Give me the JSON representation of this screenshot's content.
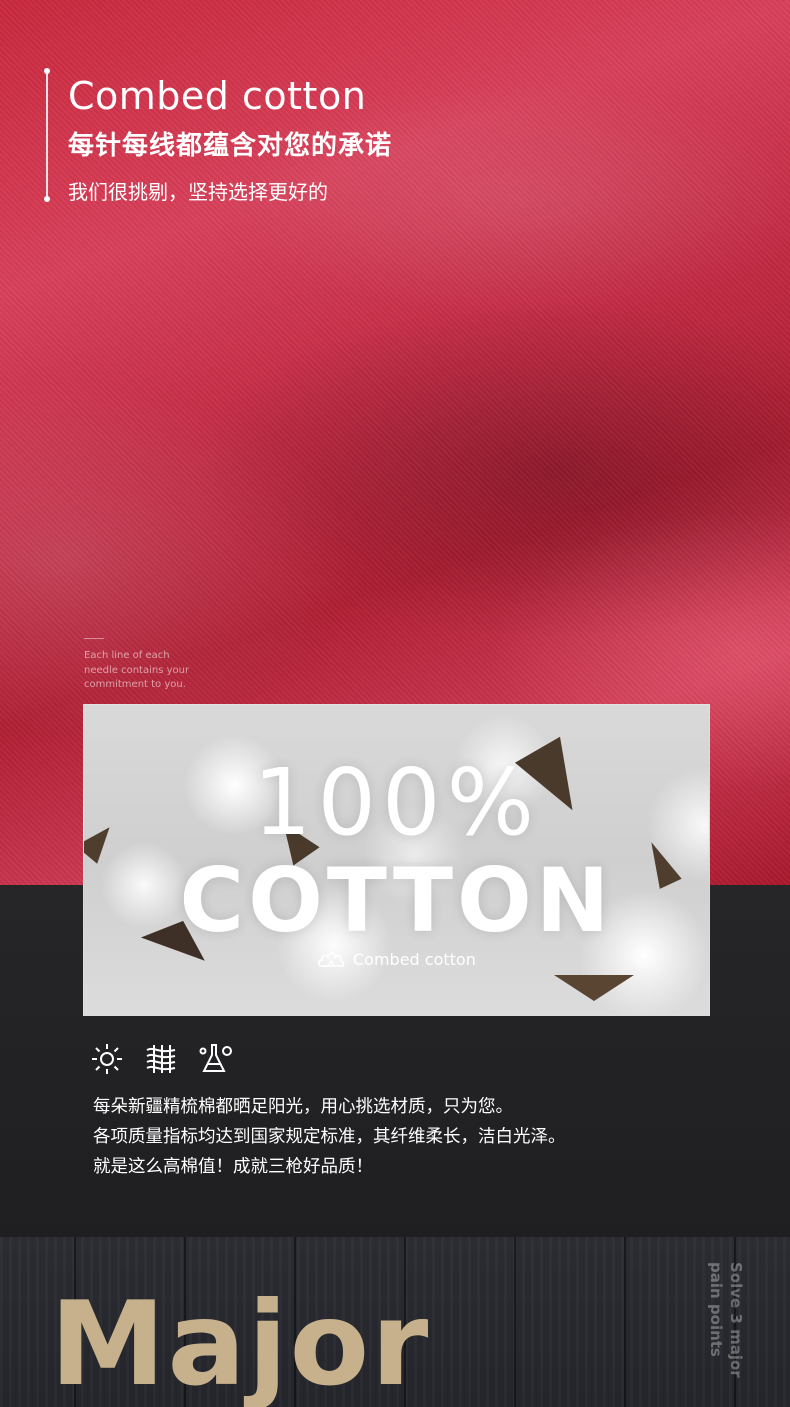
{
  "header": {
    "title": "Combed cotton",
    "subtitle": "每针每线都蕴含对您的承诺",
    "tagline": "我们很挑剔，坚持选择更好的"
  },
  "side_note": {
    "lines": [
      "Each line of each",
      "needle contains your",
      "commitment to you."
    ]
  },
  "card": {
    "percent": "100%",
    "word": "COTTON",
    "badge": "Combed  cotton",
    "badge_icon": "cotton-boll-icon"
  },
  "features": {
    "icons": [
      "sun-icon",
      "fiber-icon",
      "flask-icon"
    ],
    "lines": [
      "每朵新疆精梳棉都晒足阳光，用心挑选材质，只为您。",
      "各项质量指标均达到国家规定标准，其纤维柔长，洁白光泽。",
      "就是这么高棉值！成就三枪好品质！"
    ]
  },
  "footer": {
    "headline": "Major",
    "vertical_lines": [
      "Solve 3 major",
      "pain points"
    ]
  },
  "colors": {
    "fabric_red": "#c9283d",
    "dark_bg": "#1f1f21",
    "gold": "#c7b18d",
    "white": "#ffffff"
  }
}
